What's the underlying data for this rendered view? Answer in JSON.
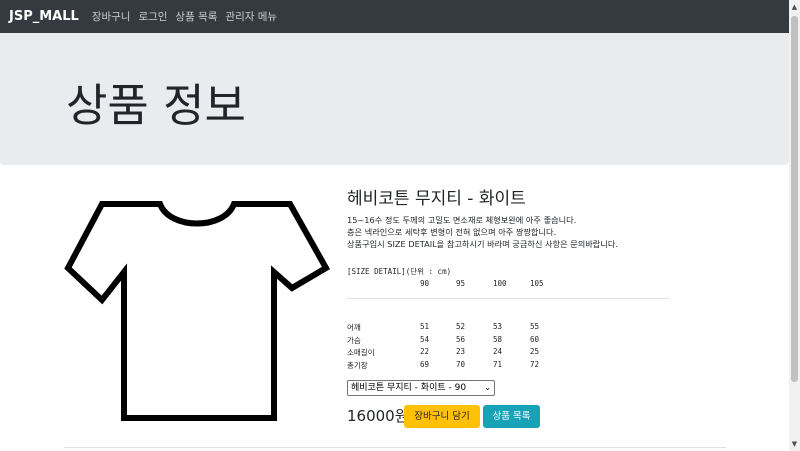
{
  "navbar": {
    "brand": "JSP_MALL",
    "links": [
      "장바구니",
      "로그인",
      "상품 목록",
      "관리자 메뉴"
    ]
  },
  "jumbotron": {
    "title": "상품 정보"
  },
  "product": {
    "name": "헤비코튼 무지티 - 화이트",
    "description": [
      "15~16수 정도 두께의 고밀도 면소재로 체형보완에 아주 좋습니다.",
      "층은 넥라인으로 세탁후 변형이 전혀 없으며 아주 짱짱합니다.",
      "상품구입시 SIZE DETAIL을 참고하시기 바라며 궁금하신 사항은 문의바랍니다."
    ],
    "size_title": "[SIZE DETAIL](단위 : cm)",
    "size_headers": [
      "90",
      "95",
      "100",
      "105"
    ],
    "size_rows": [
      {
        "label": "어깨",
        "values": [
          "51",
          "52",
          "53",
          "55"
        ]
      },
      {
        "label": "가슴",
        "values": [
          "54",
          "56",
          "58",
          "60"
        ]
      },
      {
        "label": "소매길이",
        "values": [
          "22",
          "23",
          "24",
          "25"
        ]
      },
      {
        "label": "총기장",
        "values": [
          "69",
          "70",
          "71",
          "72"
        ]
      }
    ],
    "selected_option": "헤비코튼 무지티 - 화이트 - 90",
    "price": "16000원"
  },
  "buttons": {
    "cart": "장바구니 담기",
    "list": "상품 목록"
  },
  "icons": {
    "image": "tshirt-icon",
    "select_arrow": "chevron-down-icon"
  },
  "colors": {
    "navbar": "#343a40",
    "jumbotron": "#e9ecef",
    "warning": "#ffc107",
    "info": "#17a2b8"
  }
}
